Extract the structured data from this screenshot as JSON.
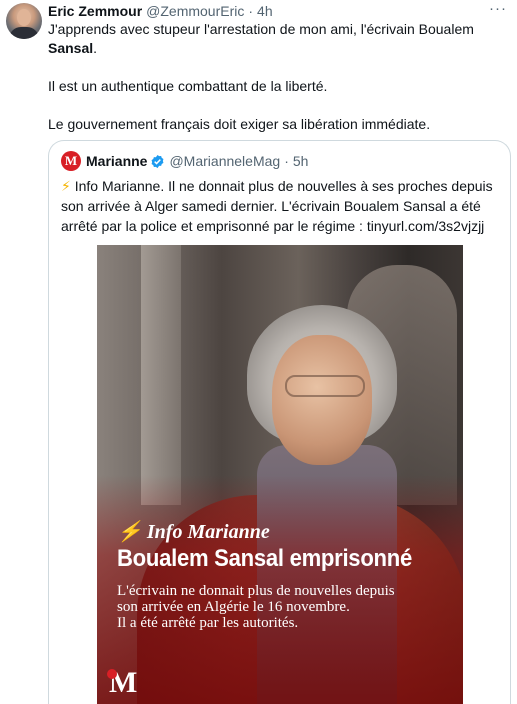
{
  "author": {
    "name": "Eric Zemmour",
    "handle": "@ZemmourEric",
    "separator": "·",
    "time": "4h",
    "more": "···"
  },
  "tweet": {
    "line1_prefix": "J'apprends avec stupeur l'arrestation de mon ami, l'écrivain Boualem",
    "line1_bold": "Sansal",
    "line1_suffix": ".",
    "para2": "Il est un authentique combattant de la liberté.",
    "para3": "Le gouvernement français doit exiger sa libération immédiate."
  },
  "quote": {
    "logo_letter": "M",
    "name": "Marianne",
    "handle": "@MarianneleMag",
    "separator": "·",
    "time": "5h",
    "bolt": "⚡",
    "text": " Info Marianne. Il ne donnait plus de nouvelles à ses proches depuis son arrivée à Alger samedi dernier. L'écrivain Boualem Sansal a été arrêté par la police et emprisonné par le régime : tinyurl.com/3s2vjzjj",
    "media": {
      "kicker": "⚡ Info Marianne",
      "title": "Boualem Sansal emprisonné",
      "subtitle_lines": [
        "L'écrivain ne donnait plus de nouvelles depuis",
        "son arrivée en Algérie le 16 novembre.",
        "Il a été arrêté par les autorités."
      ],
      "logo": "M"
    }
  },
  "colors": {
    "text": "#0f1419",
    "secondary": "#536471",
    "verified": "#1d9bf0",
    "brand_red": "#d81f26",
    "border": "#cfd9de"
  }
}
